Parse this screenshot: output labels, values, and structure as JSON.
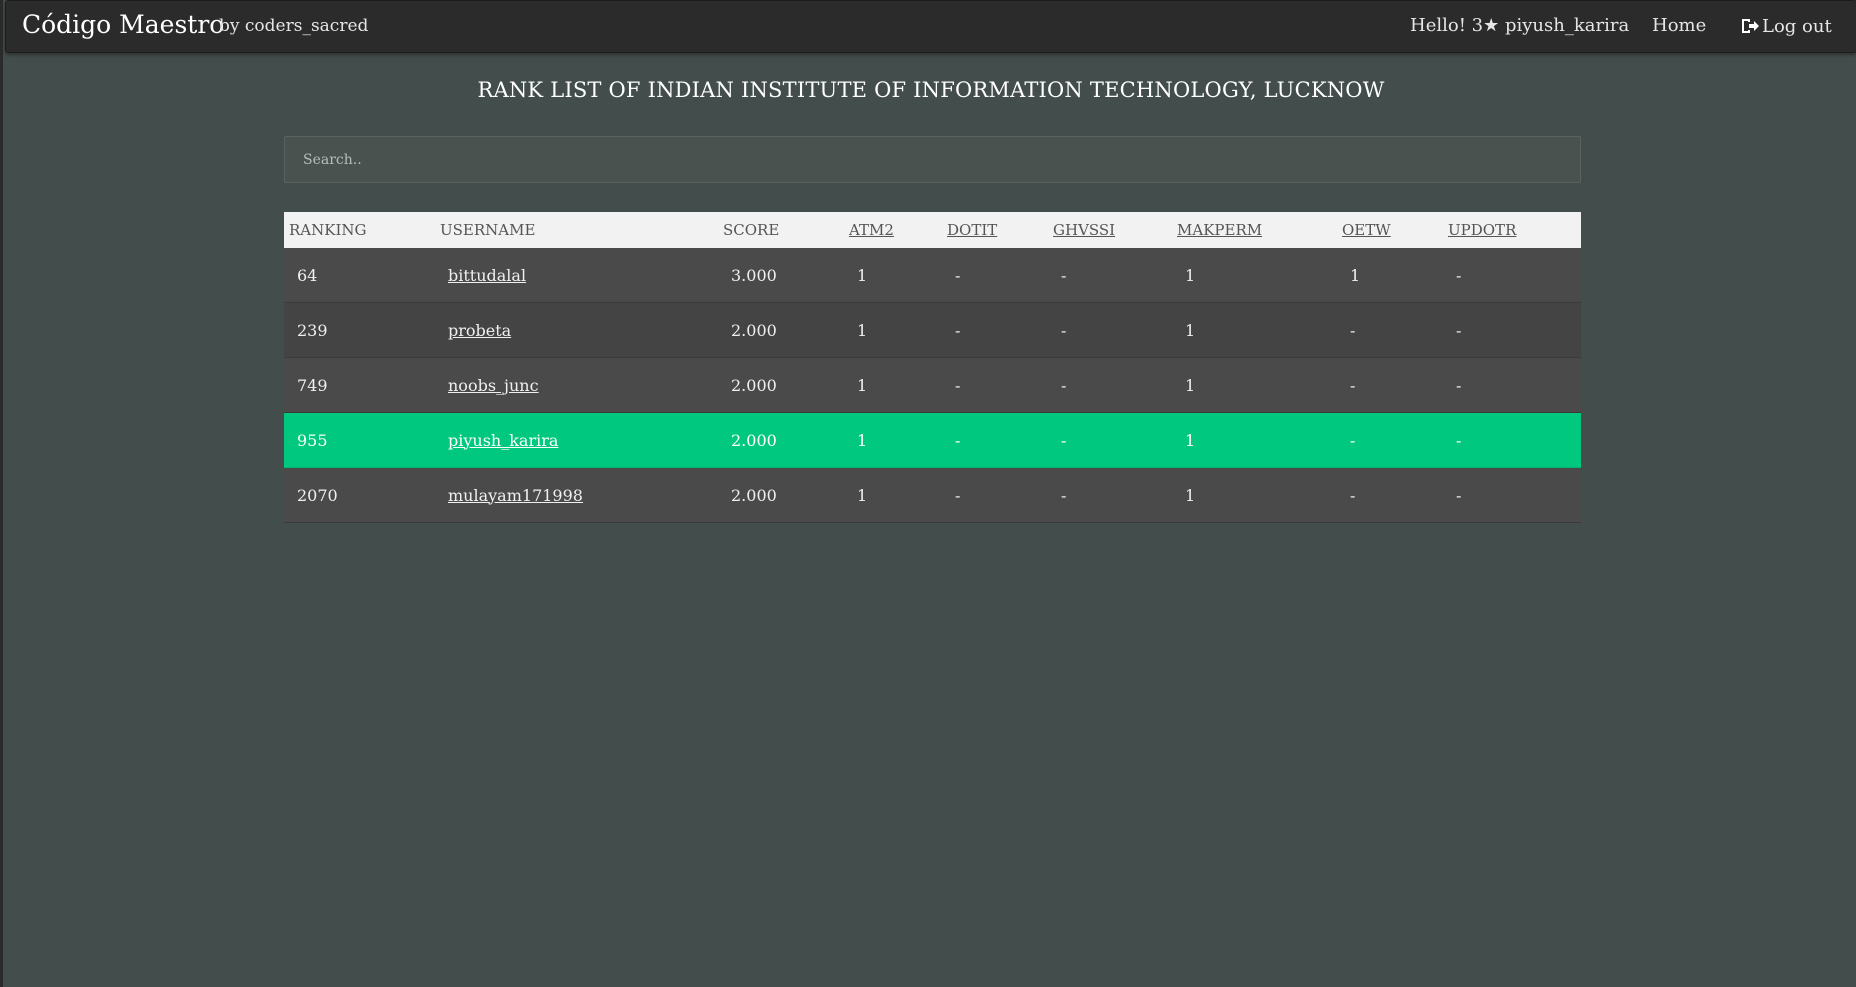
{
  "navbar": {
    "brand": "Código Maestro",
    "byline": "by coders_sacred",
    "greeting": "Hello! 3★ piyush_karira",
    "home_label": "Home",
    "logout_label": "Log out"
  },
  "page_title": "RANK LIST OF INDIAN INSTITUTE OF INFORMATION TECHNOLOGY, LUCKNOW",
  "search": {
    "placeholder": "Search..",
    "value": ""
  },
  "table": {
    "headers": [
      "RANKING",
      "USERNAME",
      "SCORE",
      "ATM2",
      "DOTIT",
      "GHVSSI",
      "MAKPERM",
      "OETW",
      "UPDOTR"
    ],
    "rows": [
      {
        "rank": "64",
        "username": "bittudalal",
        "score": "3.000",
        "atm2": "1",
        "dotit": "-",
        "ghvssi": "-",
        "makperm": "1",
        "oetw": "1",
        "updotr": "-"
      },
      {
        "rank": "239",
        "username": "probeta",
        "score": "2.000",
        "atm2": "1",
        "dotit": "-",
        "ghvssi": "-",
        "makperm": "1",
        "oetw": "-",
        "updotr": "-"
      },
      {
        "rank": "749",
        "username": "noobs_junc",
        "score": "2.000",
        "atm2": "1",
        "dotit": "-",
        "ghvssi": "-",
        "makperm": "1",
        "oetw": "-",
        "updotr": "-"
      },
      {
        "rank": "955",
        "username": "piyush_karira",
        "score": "2.000",
        "atm2": "1",
        "dotit": "-",
        "ghvssi": "-",
        "makperm": "1",
        "oetw": "-",
        "updotr": "-",
        "highlight": true
      },
      {
        "rank": "2070",
        "username": "mulayam171998",
        "score": "2.000",
        "atm2": "1",
        "dotit": "-",
        "ghvssi": "-",
        "makperm": "1",
        "oetw": "-",
        "updotr": "-"
      }
    ]
  },
  "colors": {
    "background": "#434d4b",
    "navbar": "#2b2b2b",
    "highlight_row": "#00c97f",
    "header_row": "#f2f2f2"
  },
  "icons": {
    "logout": "logout-icon"
  }
}
